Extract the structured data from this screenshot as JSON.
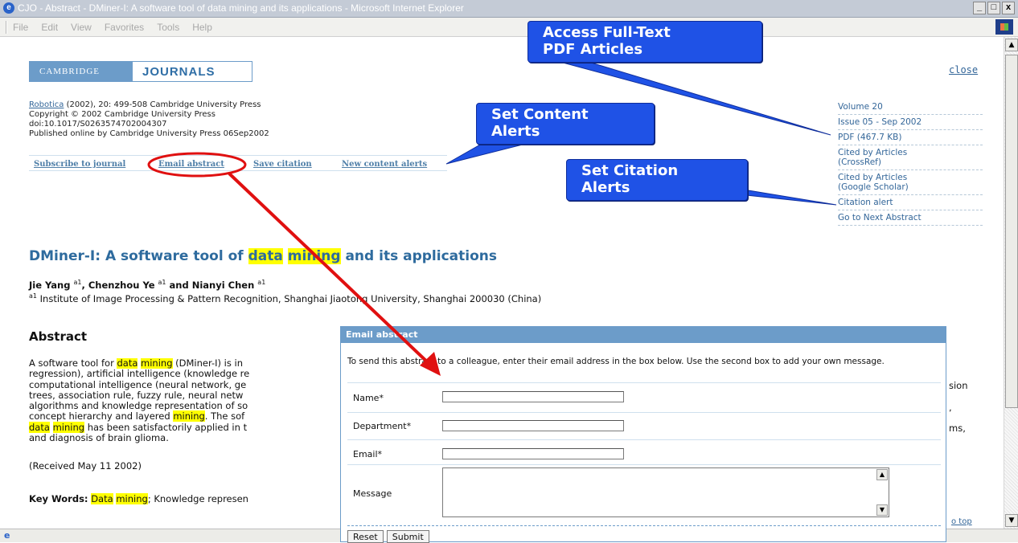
{
  "window": {
    "title": "CJO - Abstract - DMiner-I: A software tool of data mining and its applications - Microsoft Internet Explorer",
    "minimize": "_",
    "maximize": "\u0000",
    "close": "x"
  },
  "menubar": {
    "items": [
      "File",
      "Edit",
      "View",
      "Favorites",
      "Tools",
      "Help"
    ]
  },
  "logo": {
    "left": "CAMBRIDGE",
    "right": "JOURNALS"
  },
  "close_link": "close",
  "citation": {
    "journal": "Robotica",
    "line1_rest": " (2002), 20: 499-508 Cambridge University Press",
    "line2": "Copyright © 2002 Cambridge University Press",
    "line3": "doi:10.1017/S0263574702004307",
    "line4": "Published online by Cambridge University Press 06Sep2002"
  },
  "toolbar": {
    "subscribe": "Subscribe to journal",
    "email": "Email abstract",
    "save": "Save citation",
    "alerts": "New content alerts"
  },
  "right_nav": {
    "volume": "Volume 20",
    "issue": "Issue 05 - Sep 2002",
    "pdf": "PDF (467.7 KB)",
    "cited_crossref_1": "Cited by Articles",
    "cited_crossref_2": "(CrossRef)",
    "cited_google_1": "Cited by Articles",
    "cited_google_2": "(Google Scholar)",
    "citation_alert": "Citation alert",
    "next": "Go to Next Abstract"
  },
  "article": {
    "title_1": "DMiner-I: A software tool of ",
    "title_hl1": "data",
    "title_hl2": "mining",
    "title_2": " and its applications",
    "authors": "Jie Yang a1, Chenzhou Ye a1 and Nianyi Chen a1",
    "author1": "Jie Yang ",
    "author2": ", Chenzhou Ye ",
    "author3": " and Nianyi Chen ",
    "sup": "a1",
    "affiliation": " Institute of Image Processing & Pattern Recognition, Shanghai Jiaotong University, Shanghai 200030 (China)"
  },
  "abstract": {
    "heading": "Abstract",
    "l1_a": "A software tool for ",
    "l1_b": " (DMiner-I) is in",
    "l2": "regression), artificial intelligence (knowledge re",
    "l3": "computational intelligence (neural network, ge",
    "l4": "trees, association rule, fuzzy rule, neural netw",
    "l5": "algorithms and knowledge representation of so",
    "l6_a": "concept hierarchy and layered ",
    "l6_b": ". The sof",
    "l7_b": " has been satisfactorily applied in t",
    "l8": "and diagnosis of brain glioma.",
    "right1": "sion",
    "right2": ",",
    "right3": "ms,",
    "data_word": "data",
    "mining_word": "mining"
  },
  "received": "(Received May 11 2002)",
  "keywords": {
    "label": "Key Words:",
    "data": "Data",
    "mining": "mining",
    "rest": "; Knowledge represen"
  },
  "back_to_top": "o top",
  "email_dialog": {
    "header": "Email abstract",
    "intro": "To send this abstract to a colleague, enter their email address in the box below. Use the second box to add your own message.",
    "name_label": "Name*",
    "department_label": "Department*",
    "email_label": "Email*",
    "message_label": "Message",
    "reset": "Reset",
    "submit": "Submit"
  },
  "callouts": {
    "fulltext_1": "Access Full-Text",
    "fulltext_2": "PDF Articles",
    "content_1": "Set Content",
    "content_2": "Alerts",
    "citation_1": "Set Citation",
    "citation_2": "Alerts"
  },
  "colors": {
    "callout": "#1f52e6",
    "link": "#336699",
    "title": "#2e6b9e",
    "highlight": "#ffff00",
    "annotation": "#e01010"
  }
}
